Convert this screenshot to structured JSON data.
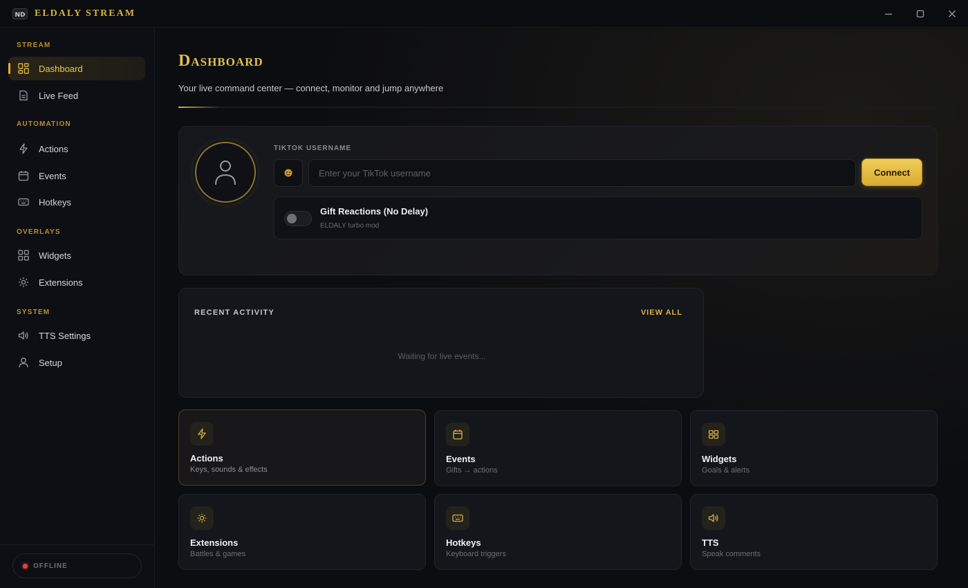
{
  "app": {
    "logo_text": "ND",
    "title": "ELDALY STREAM",
    "window_controls": [
      "minimize",
      "maximize",
      "close"
    ]
  },
  "sidebar": {
    "sections": [
      {
        "label": "STREAM",
        "items": [
          {
            "label": "Dashboard",
            "icon": "dashboard-grid-icon",
            "active": true
          },
          {
            "label": "Live Feed",
            "icon": "document-icon",
            "active": false
          }
        ]
      },
      {
        "label": "AUTOMATION",
        "items": [
          {
            "label": "Actions",
            "icon": "bolt-icon",
            "active": false
          },
          {
            "label": "Events",
            "icon": "calendar-icon",
            "active": false
          },
          {
            "label": "Hotkeys",
            "icon": "keyboard-icon",
            "active": false
          }
        ]
      },
      {
        "label": "OVERLAYS",
        "items": [
          {
            "label": "Widgets",
            "icon": "widgets-grid-icon",
            "active": false
          },
          {
            "label": "Extensions",
            "icon": "gear-icon",
            "active": false
          }
        ]
      },
      {
        "label": "SYSTEM",
        "items": [
          {
            "label": "TTS Settings",
            "icon": "speaker-icon",
            "active": false
          },
          {
            "label": "Setup",
            "icon": "user-icon",
            "active": false
          }
        ]
      }
    ],
    "status": {
      "label": "OFFLINE",
      "color": "#e0443e"
    }
  },
  "main": {
    "title": "Dashboard",
    "subtitle": "Your live command center — connect, monitor and jump anywhere",
    "connect": {
      "field_label": "TIKTOK USERNAME",
      "input_value": "",
      "input_placeholder": "Enter your TikTok username",
      "connect_label": "Connect",
      "gift_toggle": {
        "title": "Gift Reactions (No Delay)",
        "subtitle": "ELDALY turbo mod",
        "enabled": false
      }
    },
    "activity": {
      "title": "RECENT ACTIVITY",
      "view_all": "VIEW ALL",
      "empty_text": "Waiting for live events..."
    },
    "tiles": [
      {
        "title": "Actions",
        "subtitle": "Keys, sounds & effects",
        "icon": "bolt-icon"
      },
      {
        "title": "Events",
        "subtitle": "Gifts → actions",
        "icon": "calendar-icon"
      },
      {
        "title": "Widgets",
        "subtitle": "Goals & alerts",
        "icon": "widgets-grid-icon"
      },
      {
        "title": "Extensions",
        "subtitle": "Battles & games",
        "icon": "gear-icon"
      },
      {
        "title": "Hotkeys",
        "subtitle": "Keyboard triggers",
        "icon": "keyboard-icon"
      },
      {
        "title": "TTS",
        "subtitle": "Speak comments",
        "icon": "speaker-icon"
      }
    ]
  },
  "colors": {
    "accent": "#d9b23f",
    "background": "#0b0c10",
    "card": "#15161c",
    "offline": "#e0443e"
  }
}
